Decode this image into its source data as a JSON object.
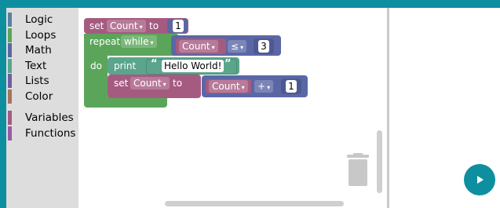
{
  "toolbox": {
    "categories": [
      {
        "label": "Logic",
        "color": "#5b80a5"
      },
      {
        "label": "Loops",
        "color": "#5ba55b"
      },
      {
        "label": "Math",
        "color": "#5b67a5"
      },
      {
        "label": "Text",
        "color": "#5ba58c"
      },
      {
        "label": "Lists",
        "color": "#745ba5"
      },
      {
        "label": "Color",
        "color": "#a5745b"
      },
      {
        "label": "Variables",
        "color": "#a55b80"
      },
      {
        "label": "Functions",
        "color": "#995ba5"
      }
    ]
  },
  "blocks": {
    "set1": {
      "keyword": "set",
      "var": "Count",
      "to": "to",
      "value": "1"
    },
    "repeat": {
      "keyword": "repeat",
      "mode": "while",
      "cond_var": "Count",
      "op": "≤",
      "limit": "3",
      "do": "do"
    },
    "print": {
      "keyword": "print",
      "open_quote": "“",
      "text": "Hello World!",
      "close_quote": "”"
    },
    "set2": {
      "keyword": "set",
      "var": "Count",
      "to": "to",
      "arith_var": "Count",
      "arith_op": "+",
      "arith_val": "1"
    }
  },
  "arrow_glyph": "▾",
  "colors": {
    "variables": "#a55b80",
    "loops": "#5ba55b",
    "math": "#5b67a5",
    "text": "#5ba58c",
    "accent": "#0e8fa0"
  },
  "controls": {
    "run_icon": "play-icon",
    "trash_icon": "trash-icon"
  }
}
